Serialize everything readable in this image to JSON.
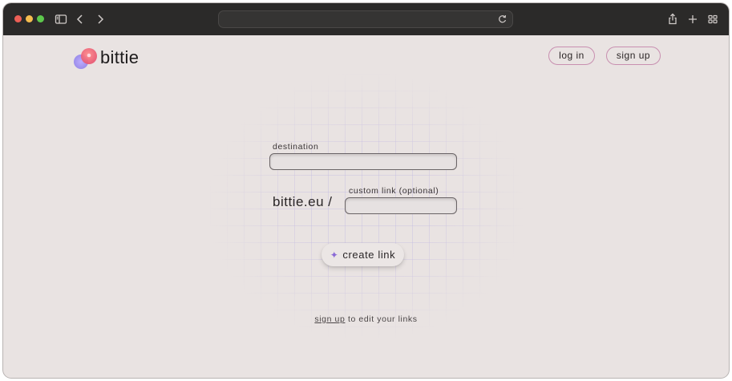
{
  "browser": {
    "url_text": "",
    "icons": [
      "sidebar-icon",
      "back-icon",
      "forward-icon",
      "reload-icon",
      "share-icon",
      "new-tab-icon",
      "tab-overview-icon"
    ]
  },
  "header": {
    "logo_text": "bittie",
    "login_label": "log in",
    "signup_label": "sign up"
  },
  "form": {
    "destination_label": "destination",
    "destination_value": "",
    "prefix": "bittie.eu /",
    "custom_label": "custom link (optional)",
    "custom_value": "",
    "create_icon": "✦",
    "create_label": "create link"
  },
  "footer": {
    "link_text": "sign up",
    "rest_text": " to edit your links"
  },
  "colors": {
    "page_bg": "#e9e3e2",
    "titlebar": "#2b2a29",
    "logo_pink": "#ef6a7e",
    "logo_purple": "#9b8cf0",
    "accent_border": "#c88fb0"
  }
}
